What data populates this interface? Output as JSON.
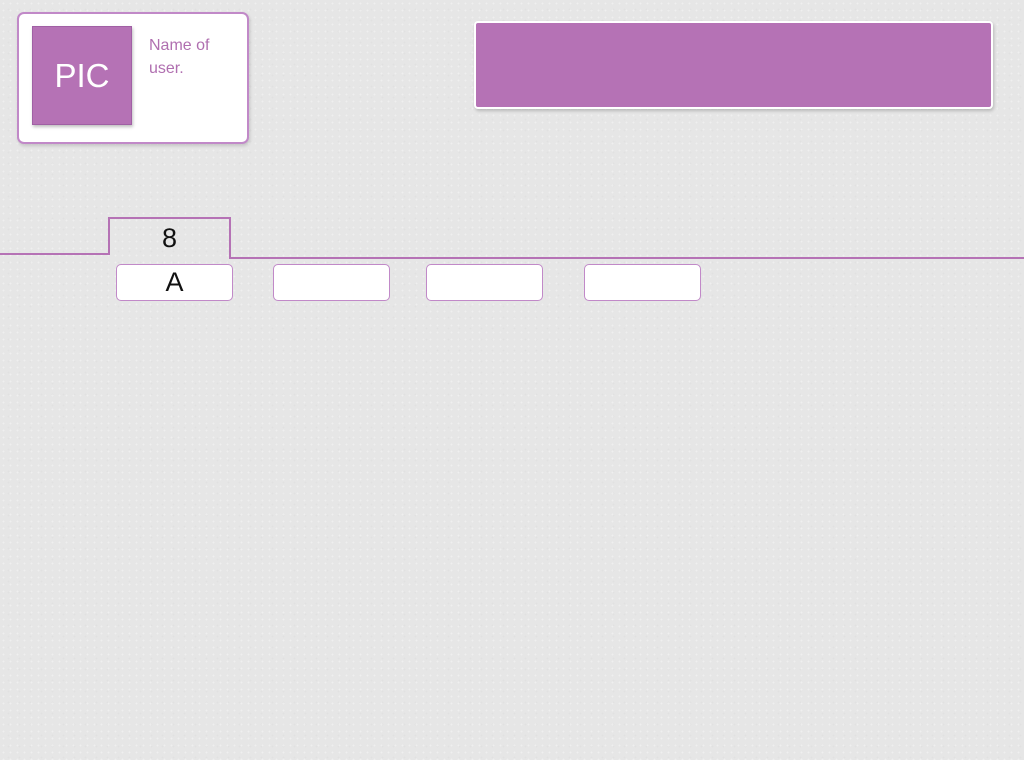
{
  "user": {
    "avatar_text": "PIC",
    "name": "Name of user."
  },
  "tab": {
    "number": "8"
  },
  "boxes": [
    {
      "label": "A"
    },
    {
      "label": ""
    },
    {
      "label": ""
    },
    {
      "label": ""
    }
  ],
  "colors": {
    "accent": "#b572b5",
    "border": "#c189c8",
    "background": "#e6e6e6",
    "text": "#111111"
  }
}
